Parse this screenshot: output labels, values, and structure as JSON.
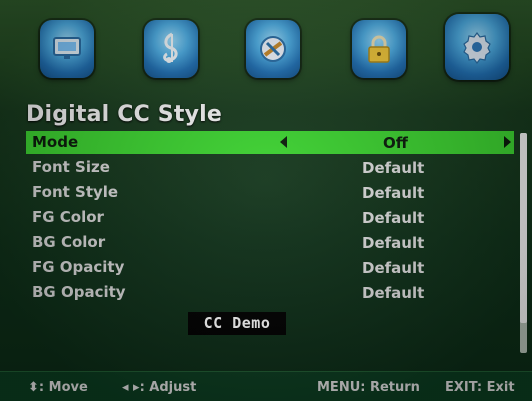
{
  "icons": [
    {
      "name": "picture-icon"
    },
    {
      "name": "sound-icon"
    },
    {
      "name": "channel-icon"
    },
    {
      "name": "lock-icon"
    },
    {
      "name": "setup-gear-icon",
      "active": true
    }
  ],
  "page": {
    "title": "Digital CC Style"
  },
  "menu": {
    "items": [
      {
        "label": "Mode",
        "value": "Off",
        "selected": true
      },
      {
        "label": "Font Size",
        "value": "Default"
      },
      {
        "label": "Font Style",
        "value": "Default"
      },
      {
        "label": "FG Color",
        "value": "Default"
      },
      {
        "label": "BG Color",
        "value": "Default"
      },
      {
        "label": "FG Opacity",
        "value": "Default"
      },
      {
        "label": "BG Opacity",
        "value": "Default"
      }
    ]
  },
  "demo": {
    "text": "CC Demo"
  },
  "footer": {
    "move_symbol": "⬍",
    "move_label": ": Move",
    "adjust_symbol": "◂ ▸",
    "adjust_label": ": Adjust",
    "return_label": "MENU: Return",
    "exit_label": "EXIT: Exit"
  },
  "colors": {
    "selected_row": "#3bd22f",
    "background": "#0f3119",
    "icon_tile": "#4fb1e8"
  }
}
